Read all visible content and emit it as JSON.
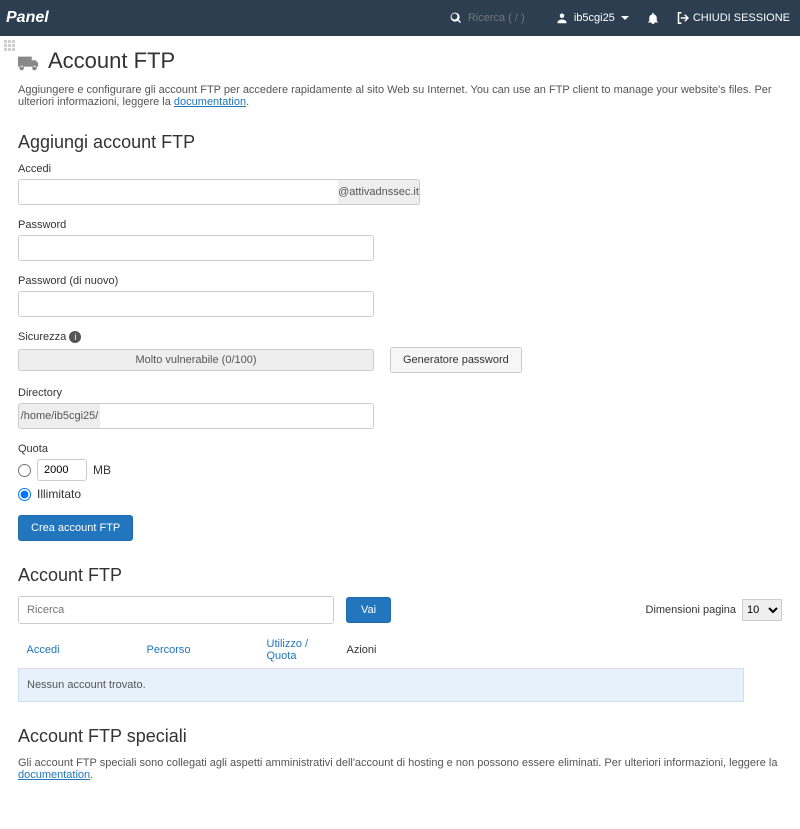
{
  "top": {
    "logo": "Panel",
    "search_placeholder": "Ricerca ( / )",
    "user": "ib5cgi25",
    "logout": "CHIUDI SESSIONE"
  },
  "page": {
    "title": "Account FTP",
    "intro": "Aggiungere e configurare gli account FTP per accedere rapidamente al sito Web su Internet. You can use an FTP client to manage your website's files. Per ulteriori informazioni, leggere la ",
    "intro_link": "documentation"
  },
  "form": {
    "heading": "Aggiungi account FTP",
    "accedi_label": "Accedi",
    "domain_suffix": "@attivadnssec.it",
    "password_label": "Password",
    "password2_label": "Password (di nuovo)",
    "sicurezza_label": "Sicurezza",
    "strength_text": "Molto vulnerabile (0/100)",
    "gen_password": "Generatore password",
    "directory_label": "Directory",
    "directory_prefix": "/home/ib5cgi25/",
    "quota_label": "Quota",
    "quota_value": "2000",
    "quota_mb": "MB",
    "illimitato": "Illimitato",
    "submit": "Crea account FTP"
  },
  "list": {
    "heading": "Account FTP",
    "search_placeholder": "Ricerca",
    "go_label": "Vai",
    "pagesize_label": "Dimensioni pagina",
    "pagesize_value": "10",
    "col_accedi": "Accedi",
    "col_percorso": "Percorso",
    "col_utilizzo": "Utilizzo",
    "col_slash": " / ",
    "col_quota": "Quota",
    "col_azioni": "Azioni",
    "empty": "Nessun account trovato."
  },
  "special": {
    "heading": "Account FTP speciali",
    "note": "Gli account FTP speciali sono collegati agli aspetti amministrativi dell'account di hosting e non possono essere eliminati. Per ulteriori informazioni, leggere la ",
    "note_link": "documentation"
  }
}
